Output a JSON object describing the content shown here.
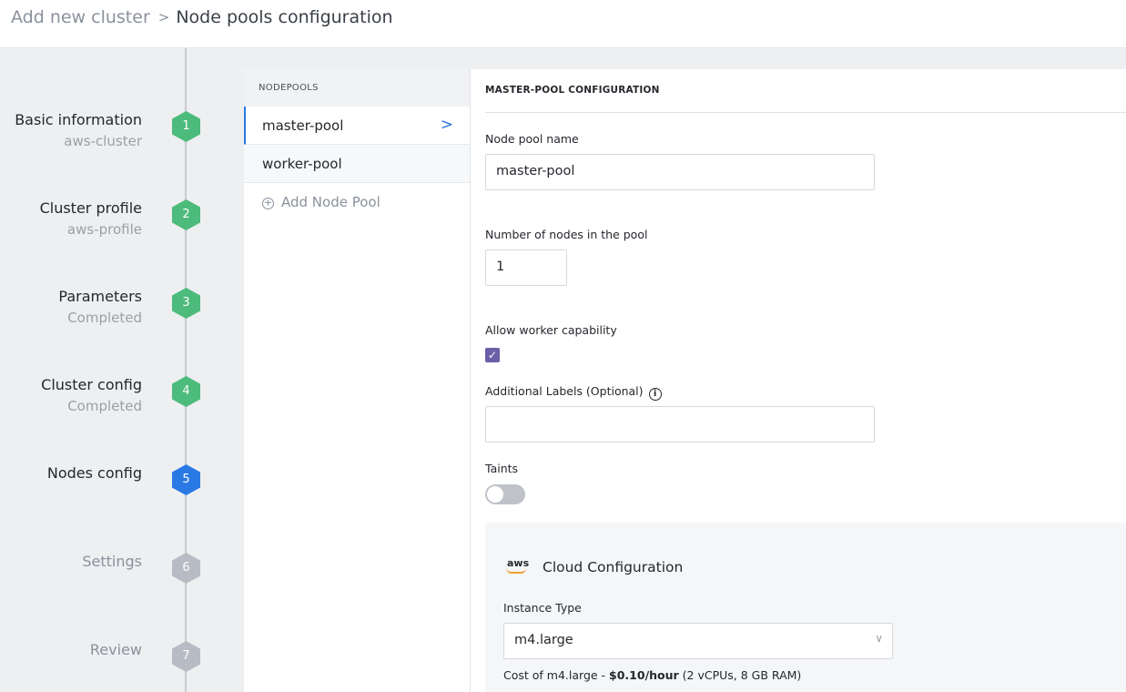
{
  "breadcrumb": {
    "root": "Add new cluster",
    "separator": ">",
    "current": "Node pools configuration"
  },
  "steps": [
    {
      "number": "1",
      "title": "Basic information",
      "subtitle": "aws-cluster",
      "state": "done"
    },
    {
      "number": "2",
      "title": "Cluster profile",
      "subtitle": "aws-profile",
      "state": "done"
    },
    {
      "number": "3",
      "title": "Parameters",
      "subtitle": "Completed",
      "state": "done"
    },
    {
      "number": "4",
      "title": "Cluster config",
      "subtitle": "Completed",
      "state": "done"
    },
    {
      "number": "5",
      "title": "Nodes config",
      "subtitle": "",
      "state": "active"
    },
    {
      "number": "6",
      "title": "Settings",
      "subtitle": "",
      "state": "pending"
    },
    {
      "number": "7",
      "title": "Review",
      "subtitle": "",
      "state": "pending"
    }
  ],
  "nodepools": {
    "header": "NODEPOOLS",
    "items": [
      {
        "label": "master-pool",
        "selected": true
      },
      {
        "label": "worker-pool",
        "selected": false
      }
    ],
    "add_label": "Add Node Pool"
  },
  "config": {
    "header": "MASTER-POOL CONFIGURATION",
    "pool_name_label": "Node pool name",
    "pool_name_value": "master-pool",
    "node_count_label": "Number of nodes in the pool",
    "node_count_value": "1",
    "worker_capability_label": "Allow worker capability",
    "worker_capability_checked": true,
    "labels_label": "Additional Labels (Optional)",
    "labels_value": "",
    "taints_label": "Taints",
    "taints_enabled": false
  },
  "cloud": {
    "provider_logo_text": "aws",
    "title": "Cloud Configuration",
    "instance_type_label": "Instance Type",
    "instance_type_value": "m4.large",
    "cost_prefix": "Cost of m4.large - ",
    "cost_value": "$0.10/hour",
    "cost_suffix": " (2 vCPUs, 8 GB RAM)"
  },
  "icons": {
    "chevron": "chevron-right-icon",
    "add": "plus-circle-icon",
    "info": "info-icon",
    "check": "check-icon",
    "caret": "chevron-down-icon"
  },
  "colors": {
    "done": "#4dbb7b",
    "active": "#2a78e4",
    "pending": "#b7bbc3",
    "checkbox": "#6a5fa8",
    "aws_orange": "#f0a12b"
  }
}
